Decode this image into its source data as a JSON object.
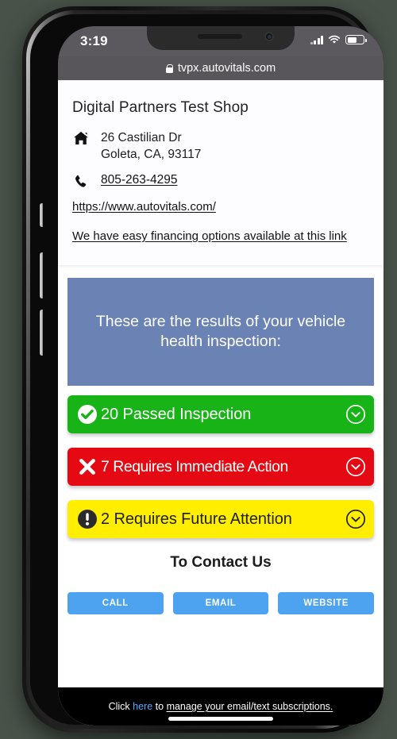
{
  "device": {
    "status_bar": {
      "time": "3:19",
      "signal_icon": "cellular-signal-icon",
      "wifi_icon": "wifi-icon",
      "battery_icon": "battery-icon"
    },
    "home_indicator": "home-indicator"
  },
  "browser": {
    "lock_icon": "lock-icon",
    "url": "tvpx.autovitals.com"
  },
  "shop": {
    "name": "Digital Partners Test Shop",
    "home_icon": "home-icon",
    "address_line1": "26 Castilian Dr",
    "address_line2": "Goleta, CA, 93117",
    "phone_icon": "phone-icon",
    "phone": "805-263-4295",
    "website": "https://www.autovitals.com/",
    "financing_text": "We have easy financing options available at this link"
  },
  "banner": {
    "text": "These are the results of your vehicle health inspection:",
    "background_color": "#6b82b4"
  },
  "results": [
    {
      "label": "20 Passed Inspection",
      "icon": "check-circle-icon",
      "chevron": "chevron-down-circle-icon",
      "color": "#17b317",
      "text_color": "#ffffff",
      "count": 20,
      "status": "passed"
    },
    {
      "label": "7 Requires Immediate Action",
      "icon": "times-circle-icon",
      "chevron": "chevron-down-circle-icon",
      "color": "#e50914",
      "text_color": "#ffffff",
      "count": 7,
      "status": "immediate"
    },
    {
      "label": "2 Requires Future Attention",
      "icon": "exclamation-circle-icon",
      "chevron": "chevron-down-circle-icon",
      "color": "#ffee00",
      "text_color": "#1f1f1f",
      "count": 2,
      "status": "future"
    }
  ],
  "contact": {
    "title": "To Contact Us",
    "buttons": [
      {
        "label": "CALL"
      },
      {
        "label": "EMAIL"
      },
      {
        "label": "WEBSITE"
      }
    ],
    "button_color": "#4da3f0"
  },
  "footer": {
    "prefix": "Click ",
    "link": "here",
    "middle": " to ",
    "suffix": "manage your email/text subscriptions.",
    "link_color": "#5aa9ff"
  }
}
